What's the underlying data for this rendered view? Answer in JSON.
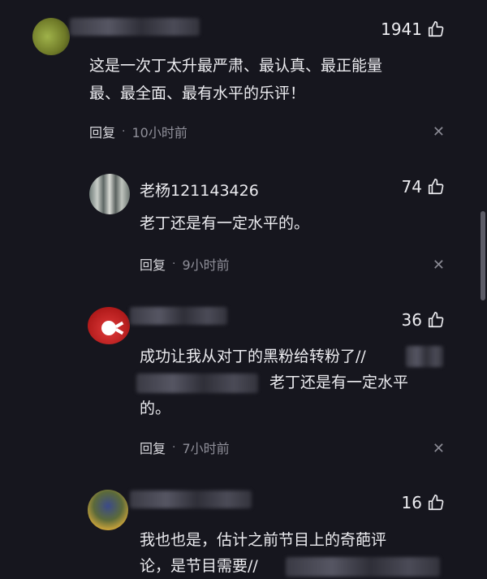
{
  "comments": [
    {
      "likes": "1941",
      "text_lines": [
        "这是一次丁太升最严肃、最认真、最正能量",
        "最、最全面、最有水平的乐评！"
      ],
      "reply": "回复",
      "time": "10小时前"
    },
    {
      "username": "老杨121143426",
      "likes": "74",
      "text_lines": [
        "老丁还是有一定水平的。"
      ],
      "reply": "回复",
      "time": "9小时前"
    },
    {
      "likes": "36",
      "text_lines": [
        "成功让我从对丁的黑粉给转粉了//",
        "老丁还是有一定水平",
        "的。"
      ],
      "reply": "回复",
      "time": "7小时前"
    },
    {
      "likes": "16",
      "text_lines": [
        "我也也是，估计之前节目上的奇葩评",
        "论，是节目需要//"
      ]
    }
  ],
  "icons": {
    "like": "thumbs-up-icon",
    "close": "close-icon"
  }
}
